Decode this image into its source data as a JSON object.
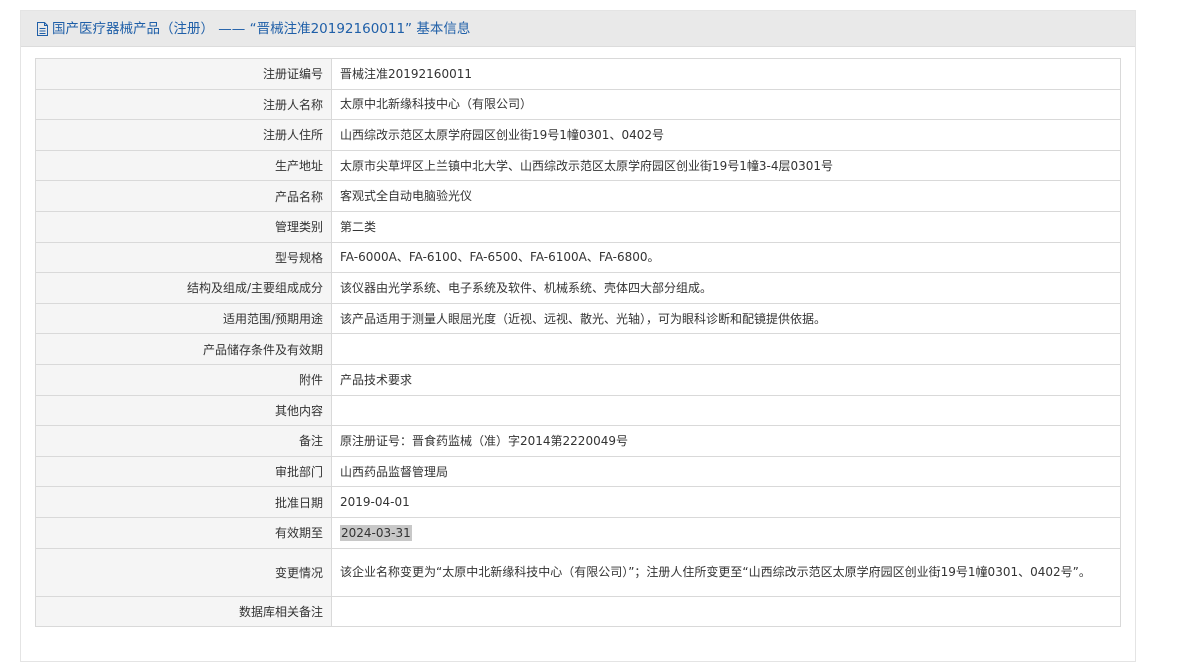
{
  "header": {
    "icon": "document-icon",
    "title": "国产医疗器械产品（注册） —— “晋械注准20192160011” 基本信息"
  },
  "rows": [
    {
      "label": "注册证编号",
      "value": "晋械注准20192160011"
    },
    {
      "label": "注册人名称",
      "value": "太原中北新缘科技中心（有限公司）"
    },
    {
      "label": "注册人住所",
      "value": "山西综改示范区太原学府园区创业街19号1幢0301、0402号"
    },
    {
      "label": "生产地址",
      "value": "太原市尖草坪区上兰镇中北大学、山西综改示范区太原学府园区创业街19号1幢3-4层0301号"
    },
    {
      "label": "产品名称",
      "value": "客观式全自动电脑验光仪"
    },
    {
      "label": "管理类别",
      "value": "第二类"
    },
    {
      "label": "型号规格",
      "value": "FA-6000A、FA-6100、FA-6500、FA-6100A、FA-6800。"
    },
    {
      "label": "结构及组成/主要组成成分",
      "value": "该仪器由光学系统、电子系统及软件、机械系统、壳体四大部分组成。"
    },
    {
      "label": "适用范围/预期用途",
      "value": "该产品适用于测量人眼屈光度（近视、远视、散光、光轴），可为眼科诊断和配镜提供依据。"
    },
    {
      "label": "产品储存条件及有效期",
      "value": ""
    },
    {
      "label": "附件",
      "value": "产品技术要求"
    },
    {
      "label": "其他内容",
      "value": ""
    },
    {
      "label": "备注",
      "value": "原注册证号：晋食药监械（准）字2014第2220049号"
    },
    {
      "label": "审批部门",
      "value": "山西药品监督管理局"
    },
    {
      "label": "批准日期",
      "value": "2019-04-01"
    },
    {
      "label": "有效期至",
      "value": "2024-03-31"
    },
    {
      "label": "变更情况",
      "value": "该企业名称变更为“太原中北新缘科技中心（有限公司）”；注册人住所变更至“山西综改示范区太原学府园区创业街19号1幢0301、0402号”。"
    },
    {
      "label": "数据库相关备注",
      "value": ""
    }
  ]
}
